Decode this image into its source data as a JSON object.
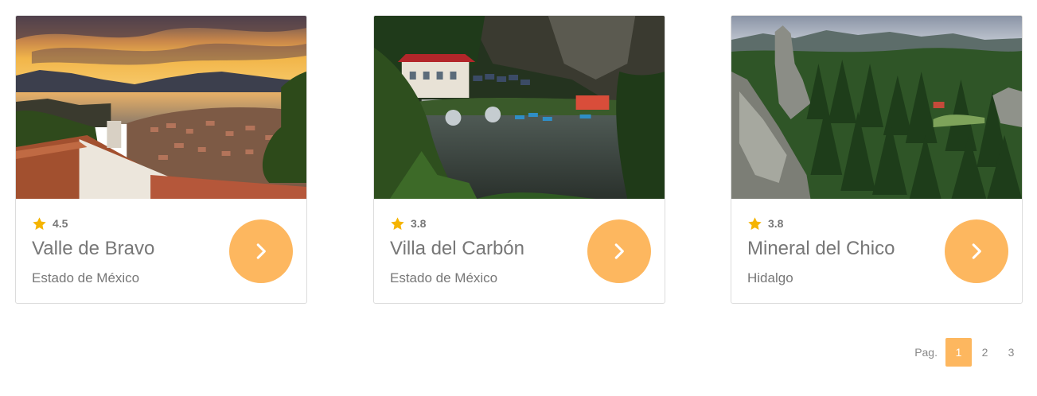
{
  "cards": [
    {
      "rating": "4.5",
      "title": "Valle de Bravo",
      "subtitle": "Estado de México"
    },
    {
      "rating": "3.8",
      "title": "Villa del Carbón",
      "subtitle": "Estado de México"
    },
    {
      "rating": "3.8",
      "title": "Mineral del Chico",
      "subtitle": "Hidalgo"
    }
  ],
  "pagination": {
    "label": "Pag.",
    "pages": [
      "1",
      "2",
      "3"
    ],
    "current": "1"
  },
  "colors": {
    "accent": "#fdb75f",
    "star": "#f5b400",
    "text": "#777777"
  },
  "icons": {
    "rating": "star-icon",
    "action": "chevron-right-icon"
  }
}
